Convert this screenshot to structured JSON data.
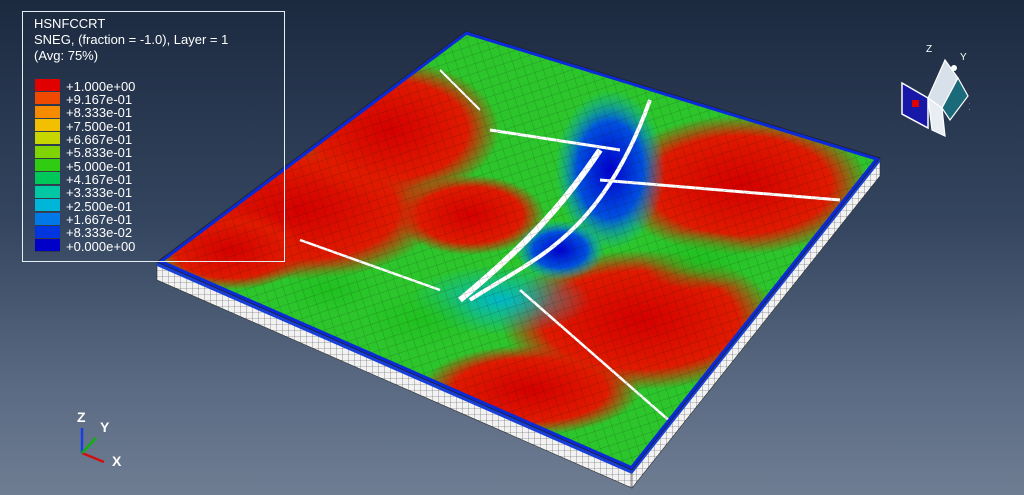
{
  "legend": {
    "title": "HSNFCCRT",
    "line2": "SNEG, (fraction = -1.0), Layer = 1",
    "line3": "(Avg: 75%)",
    "entries": [
      {
        "label": "+1.000e+00",
        "color": "#e00000"
      },
      {
        "label": "+9.167e-01",
        "color": "#f04a00"
      },
      {
        "label": "+8.333e-01",
        "color": "#f58c00"
      },
      {
        "label": "+7.500e-01",
        "color": "#f2c000"
      },
      {
        "label": "+6.667e-01",
        "color": "#c8d600"
      },
      {
        "label": "+5.833e-01",
        "color": "#7ed300"
      },
      {
        "label": "+5.000e-01",
        "color": "#2fcc12"
      },
      {
        "label": "+4.167e-01",
        "color": "#00c75a"
      },
      {
        "label": "+3.333e-01",
        "color": "#00c8a4"
      },
      {
        "label": "+2.500e-01",
        "color": "#00b6d8"
      },
      {
        "label": "+1.667e-01",
        "color": "#0078e8"
      },
      {
        "label": "+8.333e-02",
        "color": "#0036e0"
      },
      {
        "label": "+0.000e+00",
        "color": "#0000c8"
      }
    ]
  },
  "triad": {
    "x": "X",
    "y": "Y",
    "z": "Z"
  },
  "view_cube": {
    "x": "X",
    "y": "Y",
    "z": "Z"
  }
}
